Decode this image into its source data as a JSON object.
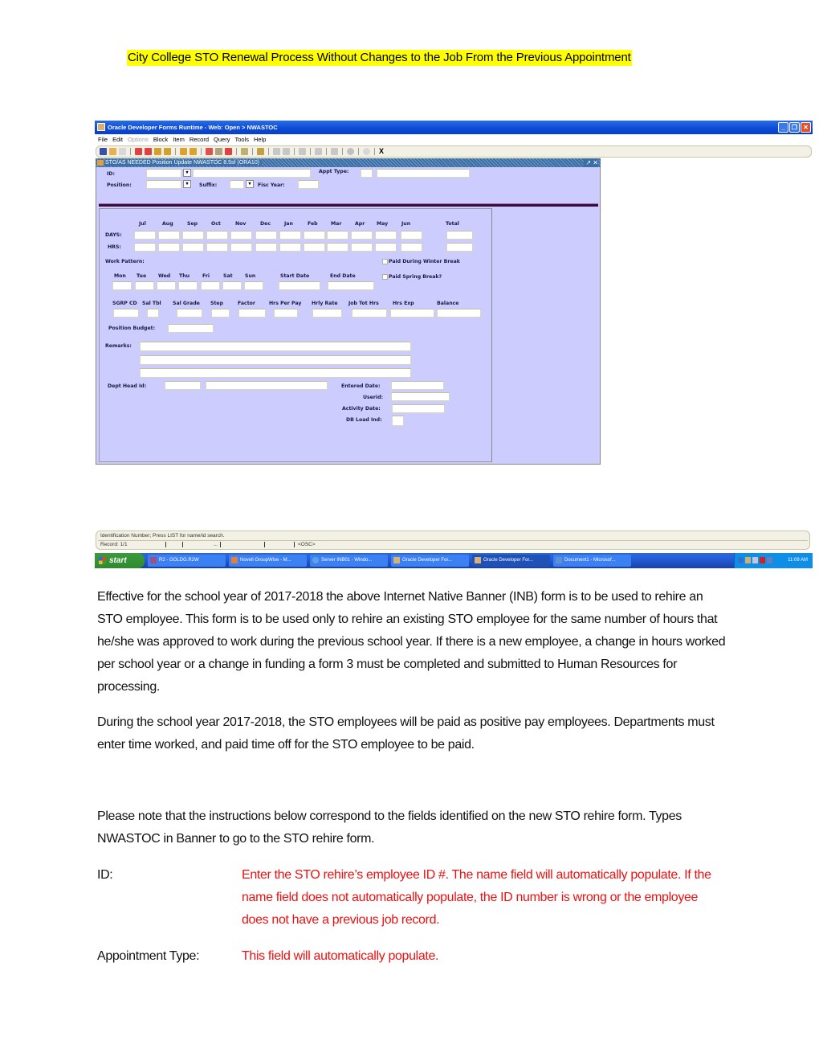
{
  "document": {
    "title": "City College STO Renewal Process Without Changes to the Job From the Previous Appointment",
    "paragraphs": [
      "Effective for the school year of 2017-2018 the above Internet Native Banner (INB) form is to be used to rehire an STO employee. This form is to be used only to rehire an existing STO employee for the same number of hours that he/she was approved to work during the previous school year.  If there is a new employee, a change in hours worked per school year or a change in funding a form 3 must be completed and submitted to Human Resources for processing.",
      "During the school year 2017-2018, the STO employees will be paid as positive pay employees. Departments must enter time worked, and paid time off for the STO employee to be paid.",
      "Please note that the instructions below correspond to the fields identified on the new STO rehire form.  Types NWASTOC in Banner to go to the STO rehire form."
    ],
    "definitions": [
      {
        "term": "ID:",
        "description": "Enter the STO rehire’s employee ID #.  The name field will automatically populate. If the name field does not automatically populate, the ID number is wrong or the employee does not have a previous job record."
      },
      {
        "term": "Appointment Type:",
        "description": "This field will automatically populate."
      }
    ],
    "colors": {
      "highlight": "#ffff00",
      "instruction_text": "#ee1111"
    }
  },
  "app": {
    "window_title": "Oracle Developer Forms Runtime - Web:  Open > NWASTOC",
    "menu": [
      {
        "label": "File",
        "disabled": false
      },
      {
        "label": "Edit",
        "disabled": false
      },
      {
        "label": "Options",
        "disabled": true
      },
      {
        "label": "Block",
        "disabled": false
      },
      {
        "label": "Item",
        "disabled": false
      },
      {
        "label": "Record",
        "disabled": false
      },
      {
        "label": "Query",
        "disabled": false
      },
      {
        "label": "Tools",
        "disabled": false
      },
      {
        "label": "Help",
        "disabled": false
      }
    ],
    "toolbar_icons": [
      "save-icon",
      "rollback-icon",
      "print-icon",
      "previous-block-icon",
      "next-block-icon",
      "previous-record-icon",
      "next-record-icon",
      "enter-query-icon",
      "execute-query-icon",
      "insert-record-icon",
      "delete-record-icon",
      "remove-record-icon",
      "print-icon",
      "attachment-icon",
      "export-icon",
      "navigate-icon",
      "options-icon",
      "switch-icon",
      "help-icon",
      "bulb-icon",
      "exit-icon"
    ],
    "exit_label": "X",
    "form_title": "STO/AS NEEDED Position Update  NWASTOC  8.5sf  (ORA10)",
    "form_controls": "↗ ✕",
    "key_block": {
      "id_label": "ID:",
      "appt_type_label": "Appt Type:",
      "position_label": "Position:",
      "suffix_label": "Suffix:",
      "fisc_year_label": "Fisc Year:",
      "dropdown_glyph": "▾"
    },
    "months": [
      "Jul",
      "Aug",
      "Sep",
      "Oct",
      "Nov",
      "Dec",
      "Jan",
      "Feb",
      "Mar",
      "Apr",
      "May",
      "Jun"
    ],
    "total_label": "Total",
    "days_label": "DAYS:",
    "hrs_label": "HRS:",
    "work_pattern_label": "Work Pattern:",
    "paid_winter_label": "Paid During Winter Break",
    "paid_spring_label": "Paid Spring Break?",
    "weekdays": [
      "Mon",
      "Tue",
      "Wed",
      "Thu",
      "Fri",
      "Sat",
      "Sun"
    ],
    "start_date_label": "Start Date",
    "end_date_label": "End Date",
    "pay_columns": [
      "SGRP CD",
      "Sal Tbl",
      "Sal Grade",
      "Step",
      "Factor",
      "Hrs Per Pay",
      "Hrly Rate",
      "Job Tot Hrs",
      "Hrs Exp",
      "Balance"
    ],
    "position_budget_label": "Position Budget:",
    "remarks_label": "Remarks:",
    "dept_head_label": "Dept Head Id:",
    "entered_date_label": "Entered Date:",
    "userid_label": "Userid:",
    "activity_date_label": "Activity Date:",
    "db_load_label": "DB Load Ind:",
    "status_message": "Identification Number; Press LIST for name/id search.",
    "record_label": "Record: 1/1",
    "status_segments": [
      "",
      "...",
      "",
      "<OSC>"
    ]
  },
  "taskbar": {
    "start_label": "start",
    "tasks": [
      {
        "label": "R2 - GOLDG.R2W",
        "active": false
      },
      {
        "label": "Novell GroupWise - M...",
        "active": false
      },
      {
        "label": "Server INB01 - Windo...",
        "active": false
      },
      {
        "label": "Oracle Developer For...",
        "active": false
      },
      {
        "label": "Oracle Developer For...",
        "active": true
      },
      {
        "label": "Document1 - Microsof...",
        "active": false
      }
    ],
    "clock": "11:09 AM"
  }
}
